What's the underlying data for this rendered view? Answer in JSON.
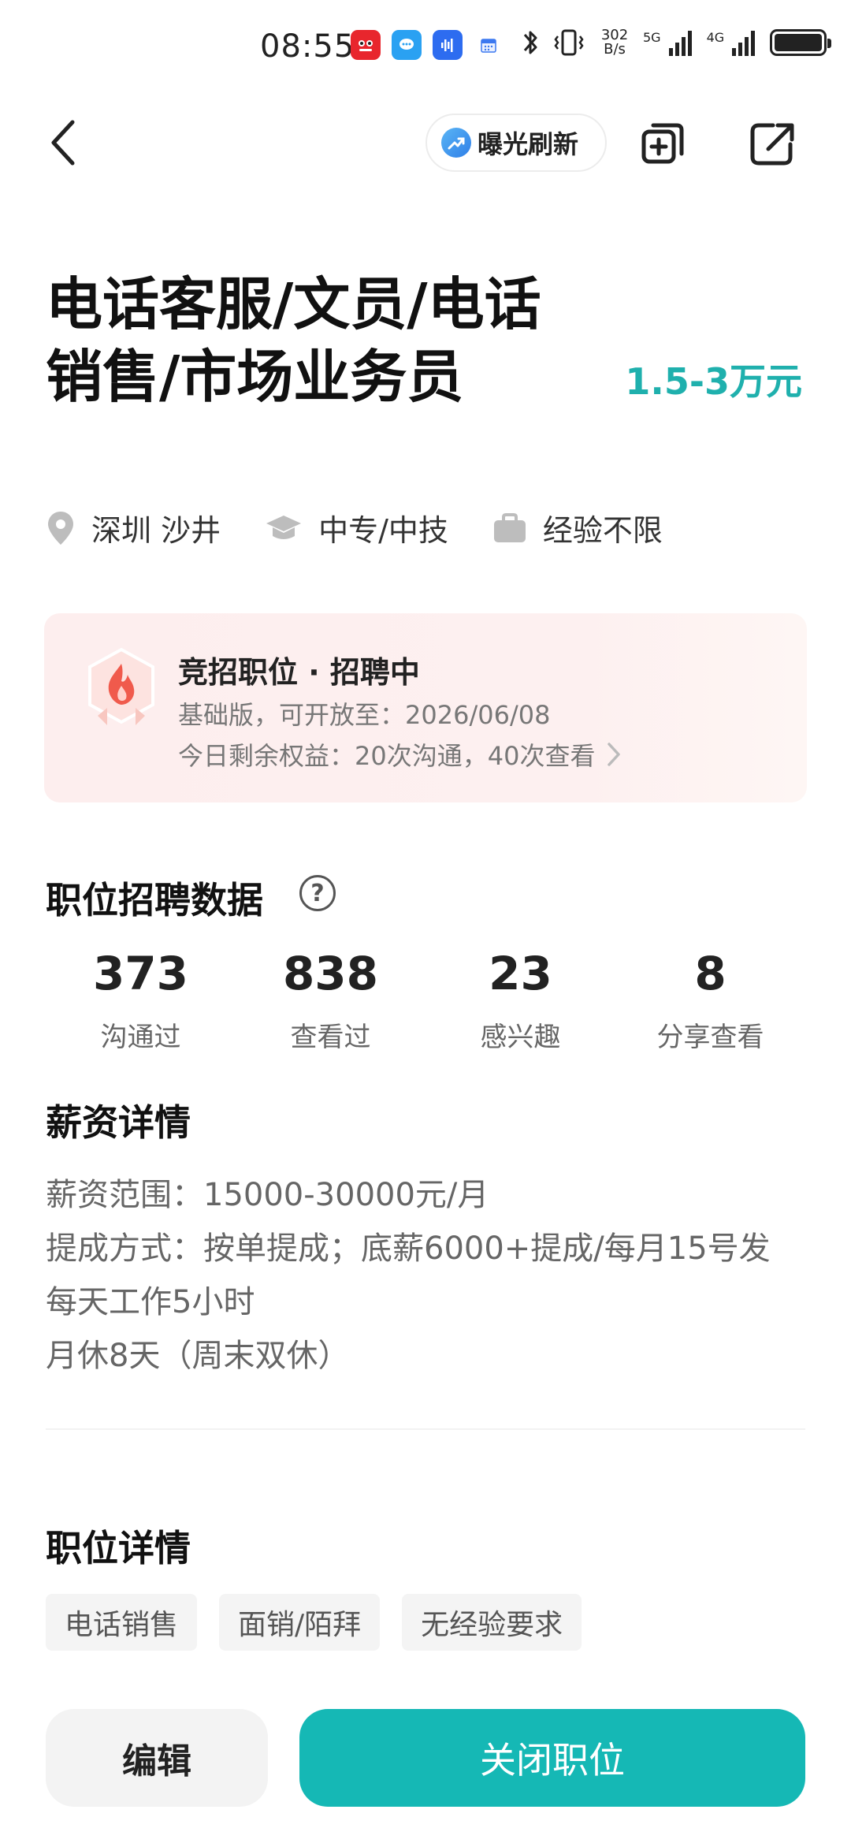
{
  "status_bar": {
    "time": "08:55",
    "net_speed_value": "302",
    "net_speed_unit": "B/s",
    "signal1_label": "5G",
    "signal2_label": "4G"
  },
  "nav": {
    "refresh_label": "曝光刷新"
  },
  "job": {
    "title": "电话客服/文员/电话销售/市场业务员",
    "salary": "1.5-3万元",
    "location": "深圳 沙井",
    "education": "中专/中技",
    "experience": "经验不限"
  },
  "competitive": {
    "title": "竞招职位 · 招聘中",
    "line1": "基础版，可开放至：2026/06/08",
    "line2": "今日剩余权益：20次沟通，40次查看"
  },
  "stats": {
    "title": "职位招聘数据",
    "items": [
      {
        "value": "373",
        "label": "沟通过"
      },
      {
        "value": "838",
        "label": "查看过"
      },
      {
        "value": "23",
        "label": "感兴趣"
      },
      {
        "value": "8",
        "label": "分享查看"
      }
    ]
  },
  "salary_detail": {
    "title": "薪资详情",
    "lines": [
      "薪资范围：15000-30000元/月",
      "提成方式：按单提成；底薪6000+提成/每月15号发",
      "每天工作5小时",
      "月休8天（周末双休）"
    ]
  },
  "job_detail": {
    "title": "职位详情",
    "tags": [
      "电话销售",
      "面销/陌拜",
      "无经验要求"
    ]
  },
  "actions": {
    "edit_label": "编辑",
    "close_label": "关闭职位"
  }
}
